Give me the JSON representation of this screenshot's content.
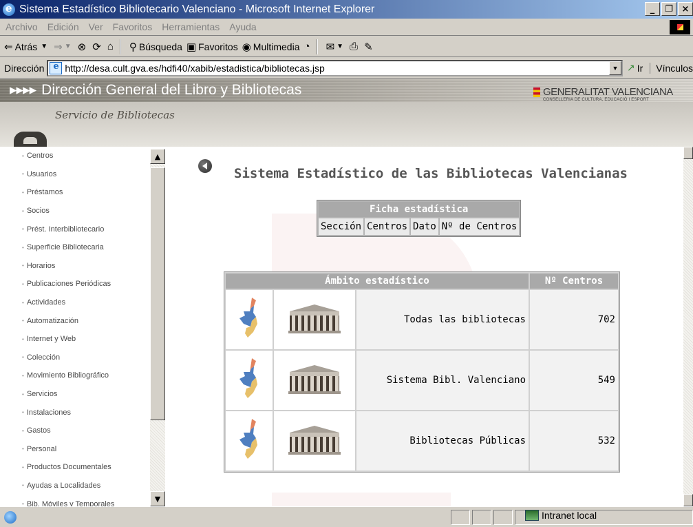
{
  "window": {
    "title": "Sistema Estadístico Bibliotecario Valenciano - Microsoft Internet Explorer",
    "buttons": {
      "minimize": "_",
      "maximize": "❐",
      "close": "×"
    }
  },
  "menu": [
    "Archivo",
    "Edición",
    "Ver",
    "Favoritos",
    "Herramientas",
    "Ayuda"
  ],
  "toolbar": {
    "back": "Atrás",
    "search": "Búsqueda",
    "favorites": "Favoritos",
    "media": "Multimedia"
  },
  "address": {
    "label": "Dirección",
    "url": "http://desa.cult.gva.es/hdfi40/xabib/estadistica/bibliotecas.jsp",
    "go": "Ir",
    "links": "Vínculos"
  },
  "banner": {
    "title": "Dirección General del Libro y Bibliotecas",
    "arrows": "▸▸▸▸",
    "subtitle": "Servicio de Bibliotecas",
    "logo_main": "GENERALITAT VALENCIANA",
    "logo_sub": "CONSELLERIA DE CULTURA, EDUCACIÓ I ESPORT"
  },
  "sidebar": {
    "items": [
      "Centros",
      "Usuarios",
      "Préstamos",
      "Socios",
      "Prést. Interbibliotecario",
      "Superficie Bibliotecaria",
      "Horarios",
      "Publicaciones Periódicas",
      "Actividades",
      "Automatización",
      "Internet y Web",
      "Colección",
      "Movimiento Bibliográfico",
      "Servicios",
      "Instalaciones",
      "Gastos",
      "Personal",
      "Productos Documentales",
      "Ayudas a Localidades",
      "Bib. Móviles y Temporales"
    ]
  },
  "main": {
    "title": "Sistema Estadístico de las Bibliotecas Valencianas",
    "ficha": {
      "header": "Ficha estadística",
      "cells": [
        "Sección",
        "Centros",
        "Dato",
        "Nº de Centros"
      ]
    },
    "ambito": {
      "header": "Ámbito estadístico",
      "count_header": "Nº Centros",
      "rows": [
        {
          "label": "Todas las bibliotecas",
          "count": "702"
        },
        {
          "label": "Sistema Bibl. Valenciano",
          "count": "549"
        },
        {
          "label": "Bibliotecas Públicas",
          "count": "532"
        }
      ]
    }
  },
  "status": {
    "zone": "Intranet local"
  },
  "colors": {
    "titlebar": "#0a246a",
    "table_header": "#a9a9a9",
    "banner": "#c9c6bf"
  }
}
